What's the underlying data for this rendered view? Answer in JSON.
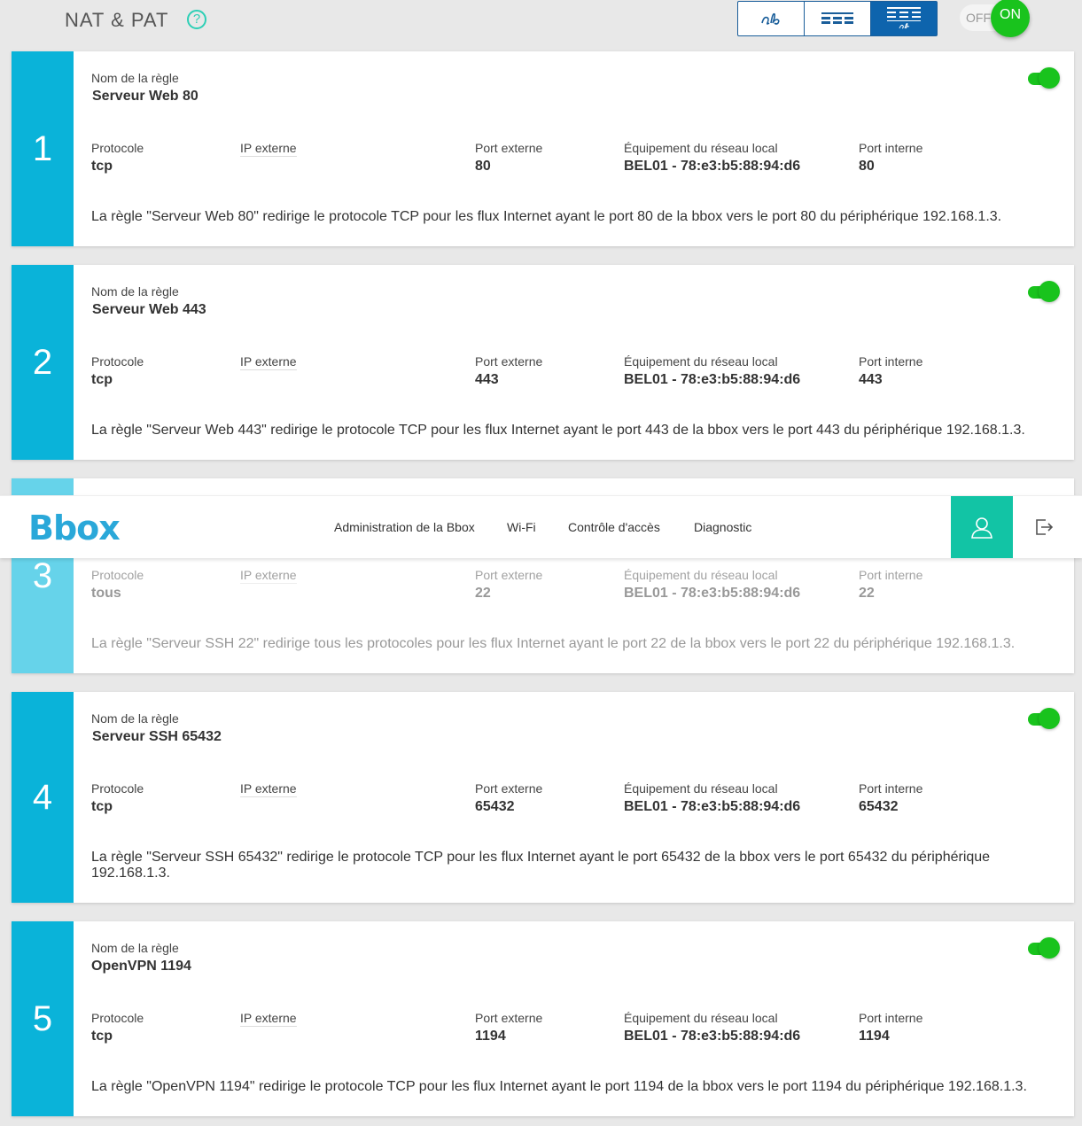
{
  "header": {
    "title": "NAT & PAT",
    "help_glyph": "?",
    "view_modes": [
      "text-view-icon",
      "table-view-icon",
      "card-view-icon"
    ],
    "active_view": "card-view-icon",
    "toggle_off": "OFF",
    "toggle_on": "ON"
  },
  "labels": {
    "rule_name": "Nom de la règle",
    "protocol": "Protocole",
    "external_ip": "IP externe",
    "external_port": "Port externe",
    "local_device": "Équipement du réseau local",
    "internal_port": "Port interne"
  },
  "rules": [
    {
      "number": "1",
      "name": "Serveur Web 80",
      "protocol": "tcp",
      "external_ip": "",
      "external_port": "80",
      "device": "BEL01 - 78:e3:b5:88:94:d6",
      "internal_port": "80",
      "enabled": true,
      "description": "La règle \"Serveur Web 80\" redirige le protocole TCP pour les flux Internet ayant le port 80 de la bbox vers le port 80 du périphérique 192.168.1.3."
    },
    {
      "number": "2",
      "name": "Serveur Web 443",
      "protocol": "tcp",
      "external_ip": "",
      "external_port": "443",
      "device": "BEL01 - 78:e3:b5:88:94:d6",
      "internal_port": "443",
      "enabled": true,
      "description": "La règle \"Serveur Web 443\" redirige le protocole TCP pour les flux Internet ayant le port 443 de la bbox vers le port 443 du périphérique 192.168.1.3."
    },
    {
      "number": "3",
      "name": "",
      "protocol": "tous",
      "external_ip": "",
      "external_port": "22",
      "device": "BEL01 - 78:e3:b5:88:94:d6",
      "internal_port": "22",
      "enabled": false,
      "description": "La règle \"Serveur SSH 22\" redirige tous les protocoles pour les flux Internet ayant le port 22 de la bbox vers le port 22 du périphérique 192.168.1.3."
    },
    {
      "number": "4",
      "name": "Serveur SSH 65432",
      "protocol": "tcp",
      "external_ip": "",
      "external_port": "65432",
      "device": "BEL01 - 78:e3:b5:88:94:d6",
      "internal_port": "65432",
      "enabled": true,
      "description": "La règle \"Serveur SSH 65432\" redirige le protocole TCP pour les flux Internet ayant le port 65432 de la bbox vers le port 65432 du périphérique 192.168.1.3."
    },
    {
      "number": "5",
      "name": "OpenVPN 1194",
      "protocol": "tcp",
      "external_ip": "",
      "external_port": "1194",
      "device": "BEL01 - 78:e3:b5:88:94:d6",
      "internal_port": "1194",
      "enabled": true,
      "description": "La règle \"OpenVPN 1194\" redirige le protocole TCP pour les flux Internet ayant le port 1194 de la bbox vers le port 1194 du périphérique 192.168.1.3."
    }
  ],
  "navbar": {
    "logo": "Bbox",
    "items": [
      "Administration de la Bbox",
      "Wi-Fi",
      "Contrôle d'accès",
      "Diagnostic"
    ],
    "user_icon": "user-icon",
    "logout_icon": "logout-icon"
  },
  "colors": {
    "rule_number_bg": "#0ab3d9",
    "toggle_on": "#19c31d",
    "user_button_bg": "#12c4a5",
    "logo": "#2aa8d9",
    "view_active": "#0e64ad"
  }
}
